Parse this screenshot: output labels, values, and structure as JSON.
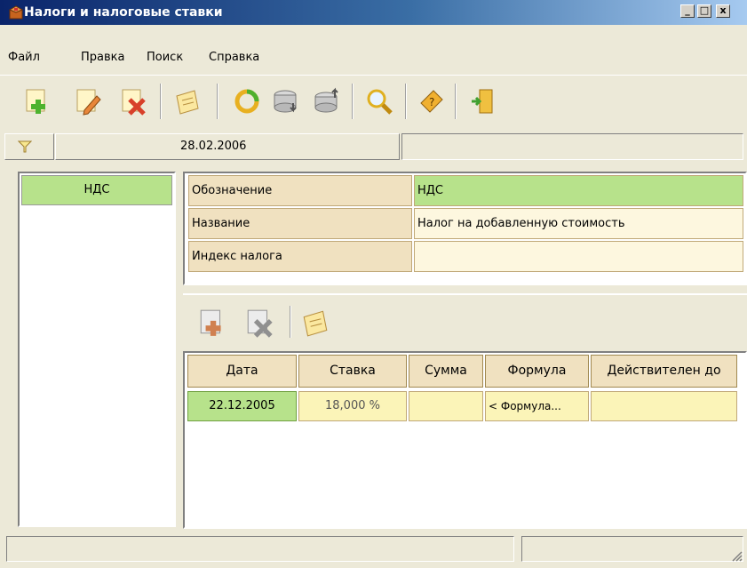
{
  "window": {
    "title": "Налоги и налоговые ставки"
  },
  "menu": {
    "items": [
      "Файл",
      "Правка",
      "Поиск",
      "Справка"
    ]
  },
  "filter": {
    "date": "28.02.2006"
  },
  "tax_list": {
    "items": [
      "НДС"
    ]
  },
  "properties": [
    {
      "label": "Обозначение",
      "value": "НДС"
    },
    {
      "label": "Название",
      "value": "Налог на добавленную стоимость"
    },
    {
      "label": "Индекс налога",
      "value": ""
    }
  ],
  "rates": {
    "columns": [
      "Дата",
      "Ставка",
      "Сумма",
      "Формула",
      "Действителен до"
    ],
    "rows": [
      {
        "date": "22.12.2005",
        "rate": "18,000 %",
        "sum": "",
        "formula": "< Формула...",
        "valid_until": ""
      }
    ]
  },
  "colors": {
    "selected_green": "#b7e28b",
    "header_tan": "#f0e1c0",
    "cell_yellow": "#fdf7df",
    "rate_cell": "#fbf4b8"
  }
}
